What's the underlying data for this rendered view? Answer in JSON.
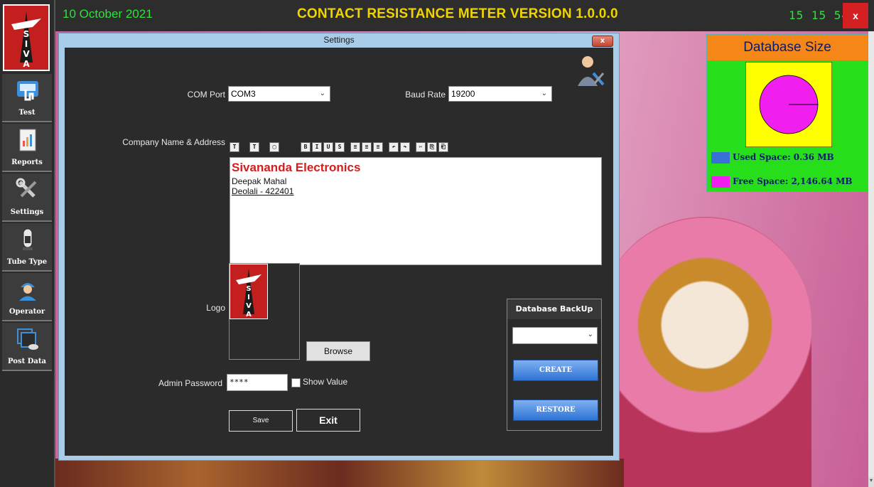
{
  "header": {
    "date": "10 October 2021",
    "title": "CONTACT RESISTANCE METER VERSION 1.0.0.0",
    "clock": "15 15 54",
    "close_label": "x"
  },
  "sidebar": {
    "logo_letters": [
      "S",
      "I",
      "V",
      "A"
    ],
    "items": [
      {
        "label": "Test",
        "icon": "test-probe-icon"
      },
      {
        "label": "Reports",
        "icon": "reports-icon"
      },
      {
        "label": "Settings",
        "icon": "settings-tools-icon"
      },
      {
        "label": "Tube Type",
        "icon": "vacuum-tube-icon"
      },
      {
        "label": "Operator",
        "icon": "operator-icon"
      },
      {
        "label": "Post Data",
        "icon": "post-data-icon"
      }
    ]
  },
  "settings": {
    "title": "Settings",
    "close_label": "x",
    "com_port_label": "COM Port",
    "com_port_value": "COM3",
    "baud_rate_label": "Baud Rate",
    "baud_rate_value": "19200",
    "company_label": "Company Name & Address",
    "company_lines": [
      "Sivananda Electronics",
      "Deepak Mahal",
      "Deolali - 422401"
    ],
    "toolbar": [
      "T",
      "T",
      "▢",
      "B",
      "I",
      "U",
      "S",
      "≡",
      "≡",
      "≡",
      "↶",
      "↷",
      "✂",
      "⎘",
      "⎗"
    ],
    "logo_label": "Logo",
    "logo_letters": [
      "S",
      "I",
      "V",
      "A"
    ],
    "browse_label": "Browse",
    "admin_password_label": "Admin Password",
    "admin_password_value": "****",
    "show_value_label": "Show Value",
    "save_label": "Save",
    "exit_label": "Exit"
  },
  "backup": {
    "title": "Database BackUp",
    "create_label": "CREATE",
    "restore_label": "RESTORE"
  },
  "database_size": {
    "title": "Database Size",
    "used_label": "Used Space: 0.36 MB",
    "free_label": "Free Space: 2,146.64 MB",
    "used_color": "#3a6fd8",
    "free_color": "#f01ff0",
    "used_mb": 0.36,
    "free_mb": 2146.64
  },
  "chart_data": {
    "type": "pie",
    "categories": [
      "Used Space",
      "Free Space"
    ],
    "values": [
      0.36,
      2146.64
    ],
    "title": "Database Size"
  }
}
